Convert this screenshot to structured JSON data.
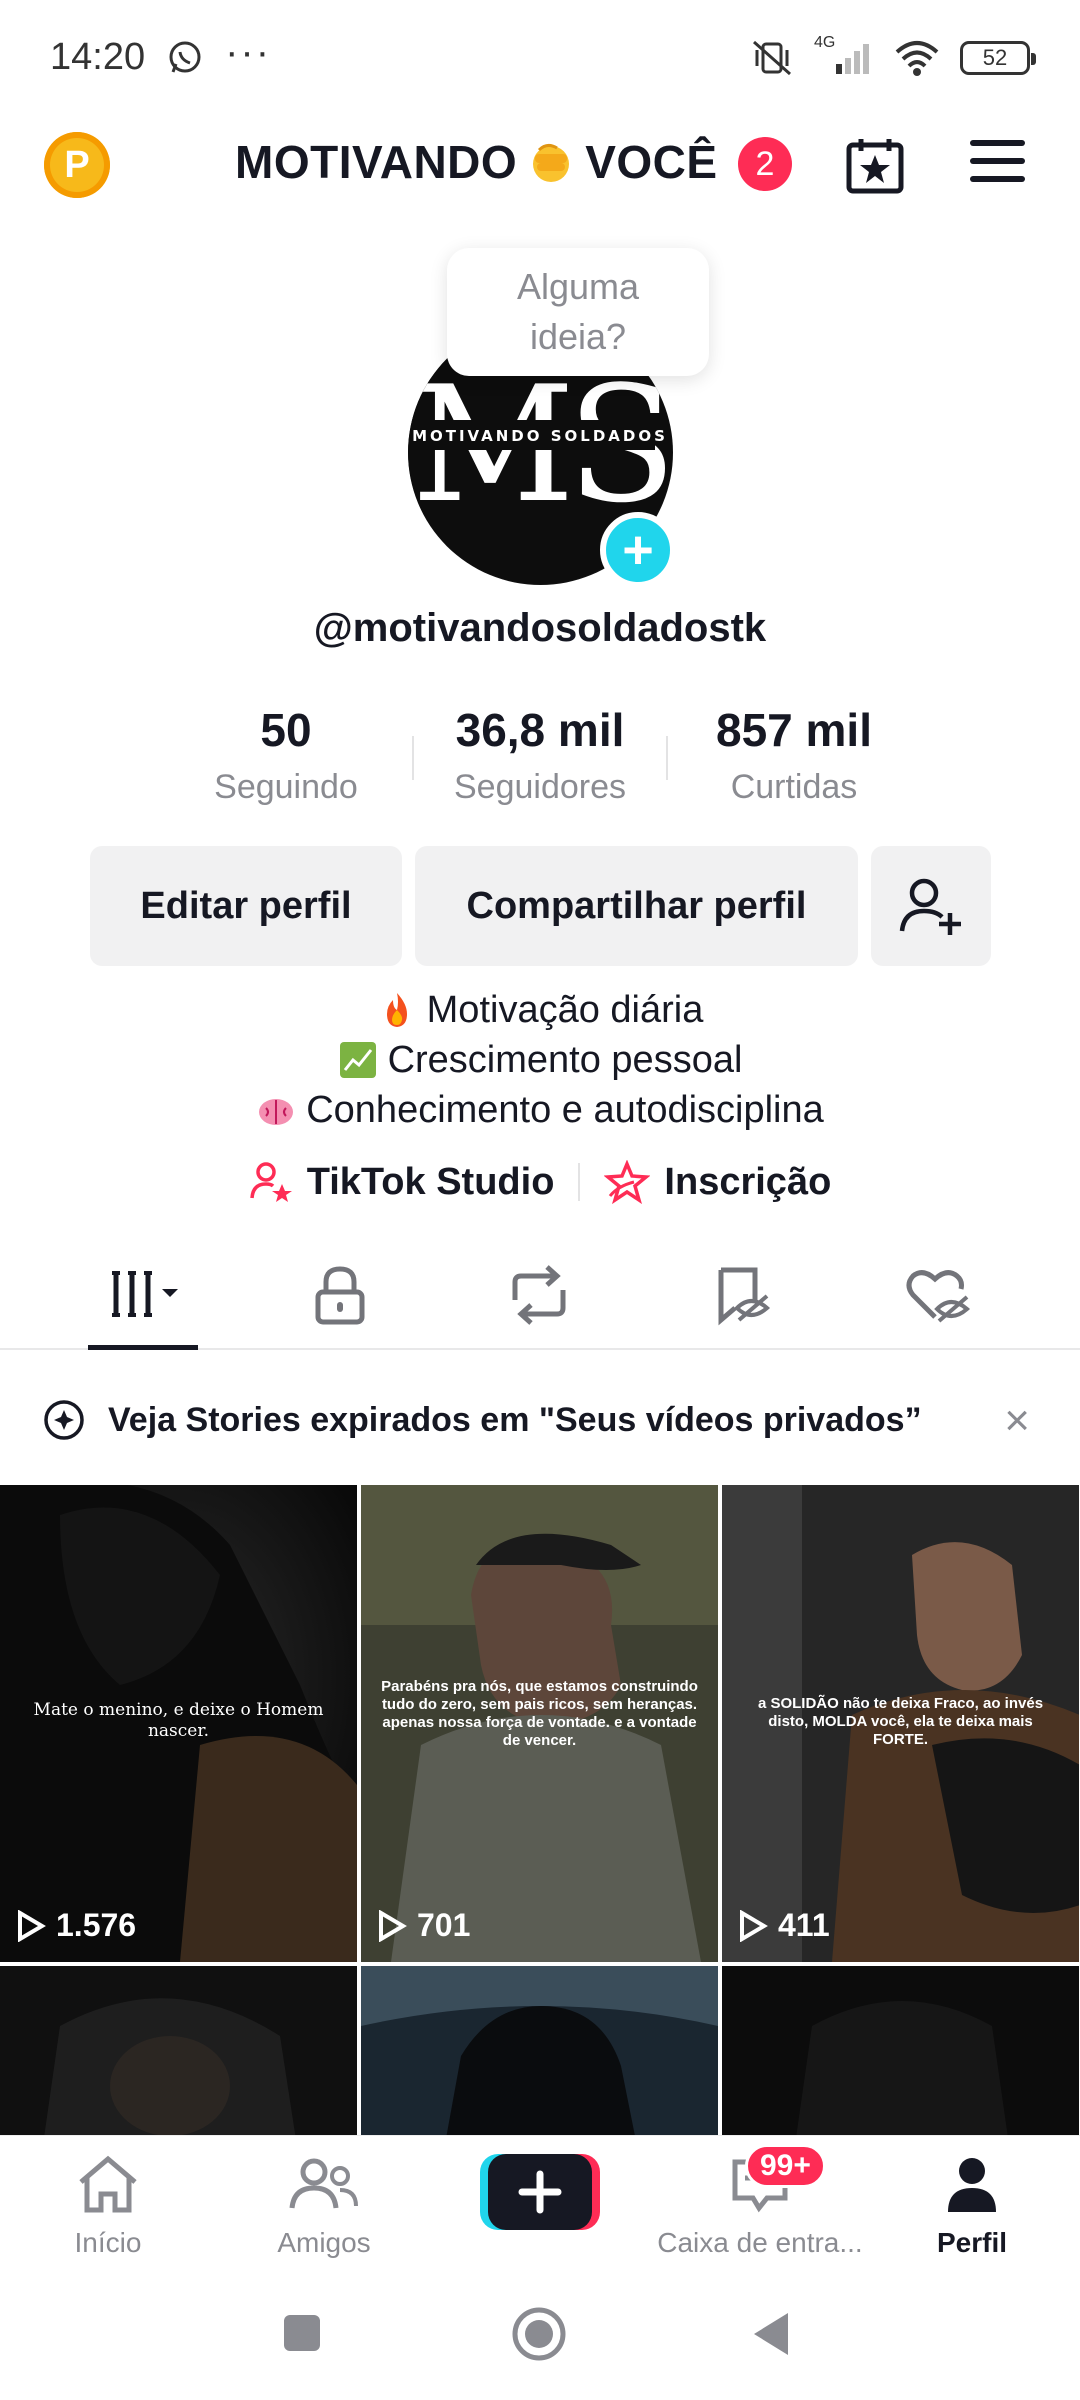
{
  "status_bar": {
    "time": "14:20",
    "network": "4G",
    "battery": "52"
  },
  "header": {
    "account_name_left": "MOTIVANDO",
    "account_name_right": "VOCÊ",
    "notification_count": "2"
  },
  "profile": {
    "idea_prompt_line1": "Alguma",
    "idea_prompt_line2": "ideia?",
    "avatar_text": "MOTIVANDO SOLDADOS",
    "username": "@motivandosoldadostk"
  },
  "stats": [
    {
      "value": "50",
      "label": "Seguindo"
    },
    {
      "value": "36,8 mil",
      "label": "Seguidores"
    },
    {
      "value": "857 mil",
      "label": "Curtidas"
    }
  ],
  "buttons": {
    "edit": "Editar perfil",
    "share": "Compartilhar perfil"
  },
  "bio": [
    {
      "emoji": "fire-icon",
      "text": "Motivação diária"
    },
    {
      "emoji": "chart-icon",
      "text": "Crescimento pessoal"
    },
    {
      "emoji": "brain-icon",
      "text": "Conhecimento e autodisciplina"
    }
  ],
  "links": {
    "studio": "TikTok Studio",
    "subscription": "Inscrição"
  },
  "banner": {
    "text": "Veja Stories expirados em \"Seus vídeos privados”",
    "close": "×"
  },
  "videos": [
    {
      "caption": "Mate o menino, e deixe o Homem nascer.",
      "views": "1.576"
    },
    {
      "caption": "Parabéns pra nós, que estamos construindo tudo do zero, sem pais ricos, sem heranças. apenas nossa força de vontade. e a vontade de vencer.",
      "views": "701"
    },
    {
      "caption": "a SOLIDÃO não te deixa Fraco, ao invés disto, MOLDA você, ela te deixa mais FORTE.",
      "views": "411"
    }
  ],
  "bottom_nav": {
    "home": "Início",
    "friends": "Amigos",
    "inbox": "Caixa de entra...",
    "inbox_badge": "99+",
    "profile": "Perfil"
  },
  "colors": {
    "accent_red": "#fe2c55",
    "accent_cyan": "#20d5ec",
    "coin": "#f7b91a"
  }
}
